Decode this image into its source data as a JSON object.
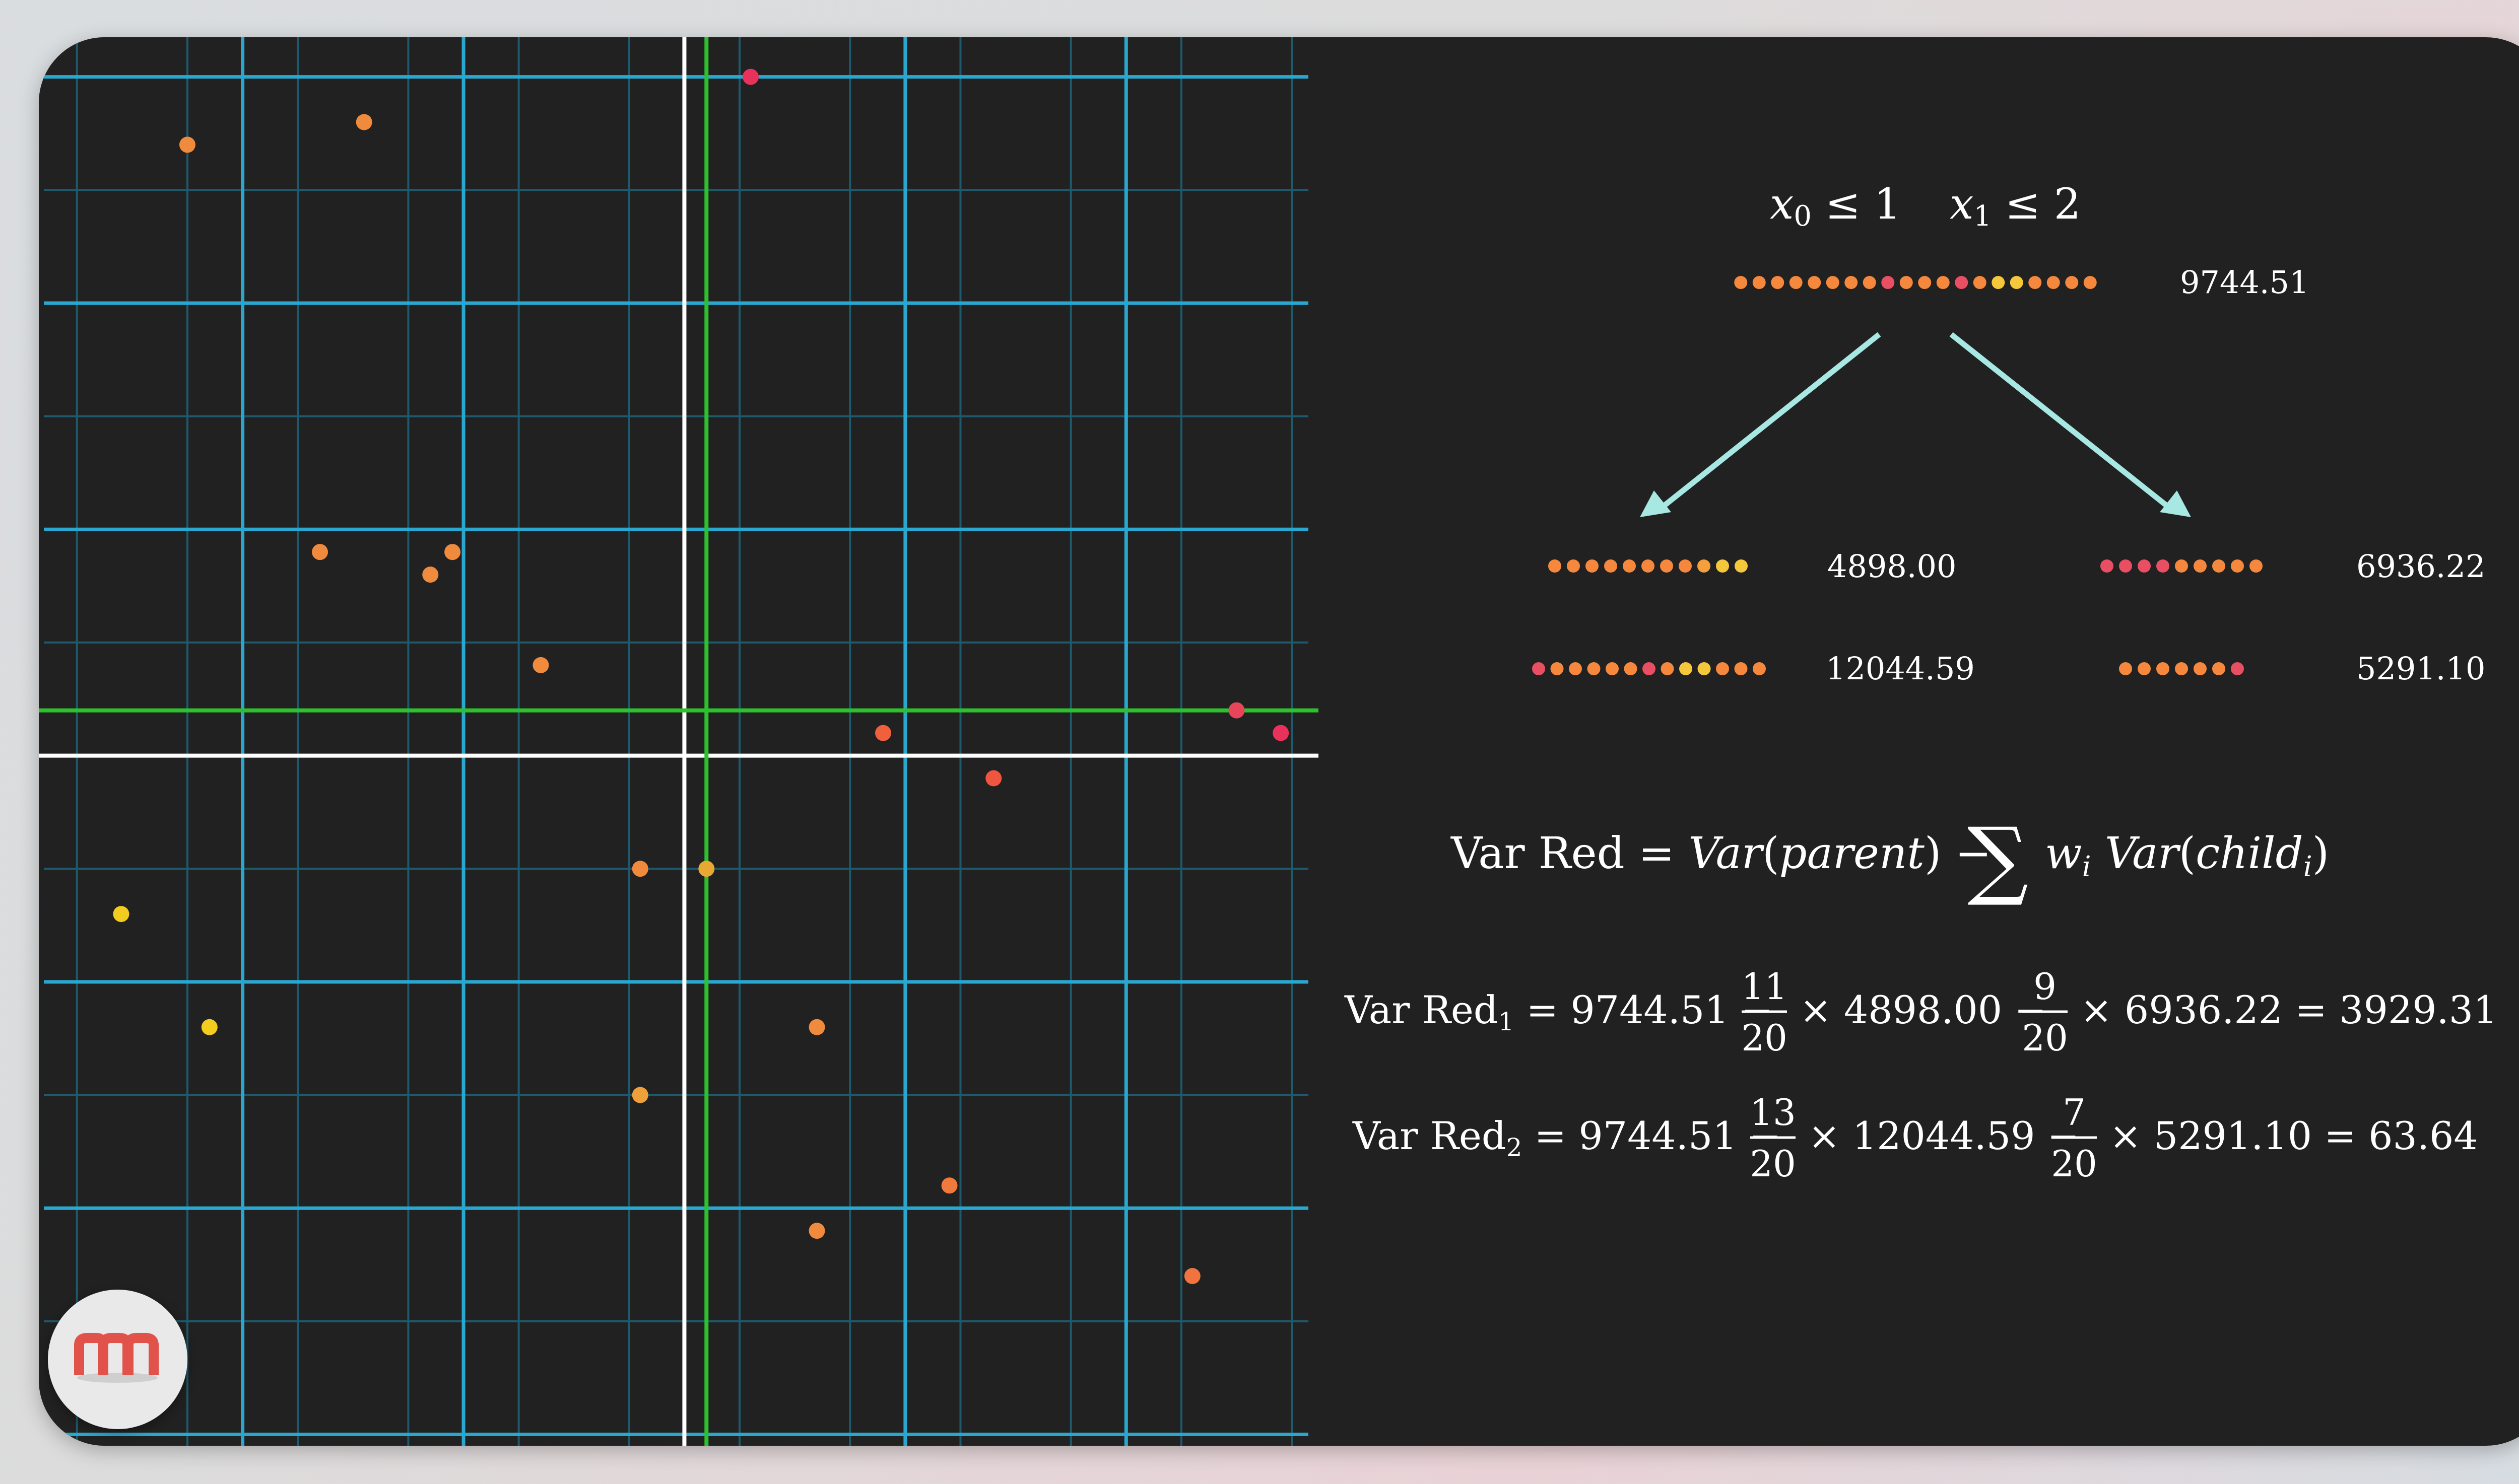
{
  "chart_data": {
    "type": "scatter",
    "points": [
      {
        "x": -4.5,
        "y": 5.4
      },
      {
        "x": -2.9,
        "y": 5.6
      },
      {
        "x": 0.6,
        "y": 6.0
      },
      {
        "x": -3.3,
        "y": 1.8
      },
      {
        "x": -2.3,
        "y": 1.6
      },
      {
        "x": -2.1,
        "y": 1.8
      },
      {
        "x": -1.3,
        "y": 0.8
      },
      {
        "x": 1.8,
        "y": 0.2
      },
      {
        "x": 5.0,
        "y": 0.4
      },
      {
        "x": 5.4,
        "y": 0.2
      },
      {
        "x": 2.8,
        "y": -0.2
      },
      {
        "x": -0.4,
        "y": -1.0
      },
      {
        "x": 0.2,
        "y": -1.0
      },
      {
        "x": -5.1,
        "y": -1.4
      },
      {
        "x": -4.3,
        "y": -2.4
      },
      {
        "x": 1.2,
        "y": -2.4
      },
      {
        "x": -0.4,
        "y": -3.0
      },
      {
        "x": 2.4,
        "y": -3.8
      },
      {
        "x": 1.2,
        "y": -4.2
      },
      {
        "x": 4.6,
        "y": -4.6
      }
    ],
    "point_colors": [
      "#f08a3c",
      "#f08a3c",
      "#e8325c",
      "#f08a3c",
      "#f08a3c",
      "#f08a3c",
      "#f08a3c",
      "#f0603c",
      "#e8445a",
      "#e8325c",
      "#f0553f",
      "#f08a3c",
      "#e8a832",
      "#f2cc1e",
      "#f2cc1e",
      "#f08a3c",
      "#f0a03a",
      "#f07a3c",
      "#f08a3c",
      "#f07340"
    ],
    "xlim": [
      -5.8,
      5.65
    ],
    "ylim": [
      -6.1,
      6.35
    ],
    "split_lines": [
      {
        "orientation": "vertical",
        "value": 0,
        "color": "#ffffff"
      },
      {
        "orientation": "horizontal",
        "value": 0,
        "color": "#ffffff"
      },
      {
        "orientation": "vertical",
        "value": 0.2,
        "color": "#2ec12e"
      },
      {
        "orientation": "horizontal",
        "value": 0.4,
        "color": "#2ec12e"
      }
    ],
    "grid": true,
    "grid_colors": {
      "major": "#2aa7cf",
      "minor": "#1d5a6e"
    }
  },
  "tree": {
    "root_condition_html": "<i>x</i><tspan font-size='70%' dy='14'>0</tspan><tspan dy='-14'> ≤ 1</tspan><tspan dx='60'></tspan><i>x</i><tspan font-size='70%' dy='14'>1</tspan><tspan dy='-14'> ≤ 2</tspan>",
    "conditions": [
      "x0 ≤ 1",
      "x1 ≤ 2"
    ],
    "root_variance": "9744.51",
    "root_dots": [
      "#f5883d",
      "#f5883d",
      "#f5883d",
      "#f5883d",
      "#f5883d",
      "#f5883d",
      "#f5883d",
      "#f5883d",
      "#e84f63",
      "#f5883d",
      "#f5883d",
      "#f5883d",
      "#e84f63",
      "#f5883d",
      "#f5c73a",
      "#f5c73a",
      "#f5883d",
      "#f5883d",
      "#f5883d",
      "#f5883d"
    ],
    "split1": {
      "left": {
        "variance": "4898.00",
        "dots": [
          "#f5883d",
          "#f5883d",
          "#f5883d",
          "#f5883d",
          "#f5883d",
          "#f5883d",
          "#f5883d",
          "#f5883d",
          "#f5a03d",
          "#f5c73a",
          "#f5c73a"
        ]
      },
      "right": {
        "variance": "6936.22",
        "dots": [
          "#e84f63",
          "#e84f63",
          "#e84f63",
          "#e84f63",
          "#f5883d",
          "#f5883d",
          "#f5883d",
          "#f5883d",
          "#f5883d"
        ]
      }
    },
    "split2": {
      "left": {
        "variance": "12044.59",
        "dots": [
          "#e84f63",
          "#f5883d",
          "#f5883d",
          "#f5883d",
          "#f5883d",
          "#f5883d",
          "#e84f63",
          "#f5883d",
          "#f5c73a",
          "#f5c73a",
          "#f5883d",
          "#f5883d",
          "#f5883d"
        ]
      },
      "right": {
        "variance": "5291.10",
        "dots": [
          "#f5883d",
          "#f5883d",
          "#f5883d",
          "#f5883d",
          "#f5883d",
          "#f5883d",
          "#e84f63"
        ]
      }
    },
    "arrow_color": "#a8e8e2"
  },
  "formulas": {
    "general": "Var Red = Var(parent) − ∑ wᵢ Var(childᵢ)",
    "red1": {
      "label": "Var Red",
      "sub": "1",
      "parent": "9744.51",
      "w_left_num": "11",
      "w_left_den": "20",
      "left": "4898.00",
      "w_right_num": "9",
      "w_right_den": "20",
      "right": "6936.22",
      "result": "3929.31"
    },
    "red2": {
      "label": "Var Red",
      "sub": "2",
      "parent": "9744.51",
      "w_left_num": "13",
      "w_left_den": "20",
      "left": "12044.59",
      "w_right_num": "7",
      "w_right_den": "20",
      "right": "5291.10",
      "result": "63.64"
    }
  },
  "logo": {
    "icon": "manim-logo",
    "letters": "m"
  }
}
